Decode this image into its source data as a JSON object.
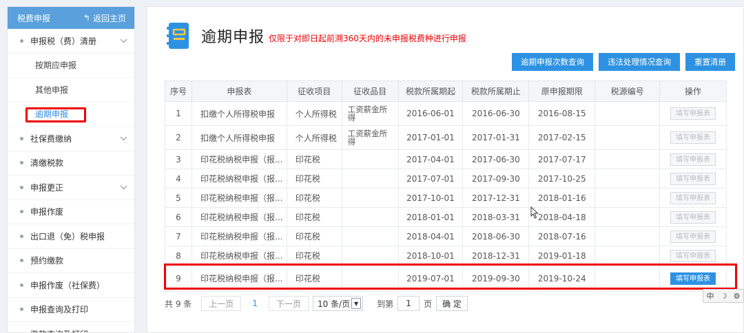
{
  "sidebar": {
    "header_title": "税费申报",
    "back_label": "返回主页",
    "items": [
      {
        "label": "申报税（费）清册",
        "expandable": true
      },
      {
        "label": "按期应申报",
        "sub": true
      },
      {
        "label": "其他申报",
        "sub": true
      },
      {
        "label": "逾期申报",
        "sub": true,
        "active": true
      },
      {
        "label": "社保费缴纳",
        "expandable": true
      },
      {
        "label": "清缴税款",
        "expandable": false
      },
      {
        "label": "申报更正",
        "expandable": true
      },
      {
        "label": "申报作废",
        "expandable": false
      },
      {
        "label": "出口退（免）税申报",
        "expandable": false
      },
      {
        "label": "预约缴款",
        "expandable": false
      },
      {
        "label": "申报作废（社保费）",
        "expandable": false
      },
      {
        "label": "申报查询及打印",
        "expandable": false
      },
      {
        "label": "缴款查询及打印",
        "expandable": false
      }
    ]
  },
  "main": {
    "title": "逾期申报",
    "note": "仅限于对即日起前溯360天内的未申报税费种进行申报",
    "buttons": [
      "逾期申报次数查询",
      "违法处理情况查询",
      "重置清册"
    ],
    "columns": [
      "序号",
      "申报表",
      "征收项目",
      "征收品目",
      "税款所属期起",
      "税款所属期止",
      "原申报期限",
      "税源编号",
      "操作"
    ],
    "rows": [
      {
        "no": "1",
        "form": "扣缴个人所得税申报",
        "item": "个人所得税",
        "sub_item": "工资薪金所得",
        "start": "2016-06-01",
        "end": "2016-06-30",
        "deadline": "2016-08-15",
        "source": "",
        "action": "填写申报表",
        "enabled": false
      },
      {
        "no": "2",
        "form": "扣缴个人所得税申报",
        "item": "个人所得税",
        "sub_item": "工资薪金所得",
        "start": "2017-01-01",
        "end": "2017-01-31",
        "deadline": "2017-02-15",
        "source": "",
        "action": "填写申报表",
        "enabled": false
      },
      {
        "no": "3",
        "form": "印花税纳税申报（报...",
        "item": "印花税",
        "sub_item": "",
        "start": "2017-04-01",
        "end": "2017-06-30",
        "deadline": "2017-07-17",
        "source": "",
        "action": "填写申报表",
        "enabled": false
      },
      {
        "no": "4",
        "form": "印花税纳税申报（报...",
        "item": "印花税",
        "sub_item": "",
        "start": "2017-07-01",
        "end": "2017-09-30",
        "deadline": "2017-10-25",
        "source": "",
        "action": "填写申报表",
        "enabled": false
      },
      {
        "no": "5",
        "form": "印花税纳税申报（报...",
        "item": "印花税",
        "sub_item": "",
        "start": "2017-10-01",
        "end": "2017-12-31",
        "deadline": "2018-01-16",
        "source": "",
        "action": "填写申报表",
        "enabled": false
      },
      {
        "no": "6",
        "form": "印花税纳税申报（报...",
        "item": "印花税",
        "sub_item": "",
        "start": "2018-01-01",
        "end": "2018-03-31",
        "deadline": "2018-04-18",
        "source": "",
        "action": "填写申报表",
        "enabled": false
      },
      {
        "no": "7",
        "form": "印花税纳税申报（报...",
        "item": "印花税",
        "sub_item": "",
        "start": "2018-04-01",
        "end": "2018-06-30",
        "deadline": "2018-07-16",
        "source": "",
        "action": "填写申报表",
        "enabled": false
      },
      {
        "no": "8",
        "form": "印花税纳税申报（报...",
        "item": "印花税",
        "sub_item": "",
        "start": "2018-10-01",
        "end": "2018-12-31",
        "deadline": "2019-01-18",
        "source": "",
        "action": "填写申报表",
        "enabled": false
      },
      {
        "no": "9",
        "form": "印花税纳税申报（报...",
        "item": "印花税",
        "sub_item": "",
        "start": "2019-07-01",
        "end": "2019-09-30",
        "deadline": "2019-10-24",
        "source": "",
        "action": "填写申报表",
        "enabled": true
      }
    ]
  },
  "pager": {
    "total": "共 9 条",
    "prev": "上一页",
    "current": "1",
    "next": "下一页",
    "size": "10 条/页",
    "goto_label": "到第",
    "goto_value": "1",
    "page_unit": "页",
    "confirm": "确 定"
  },
  "ime": {
    "lang": "中",
    "moon": "☽",
    "extra": "⚙"
  },
  "colors": {
    "accent": "#2d92e3",
    "sidebar_header": "#5aa0dc",
    "highlight": "#ee0000"
  }
}
